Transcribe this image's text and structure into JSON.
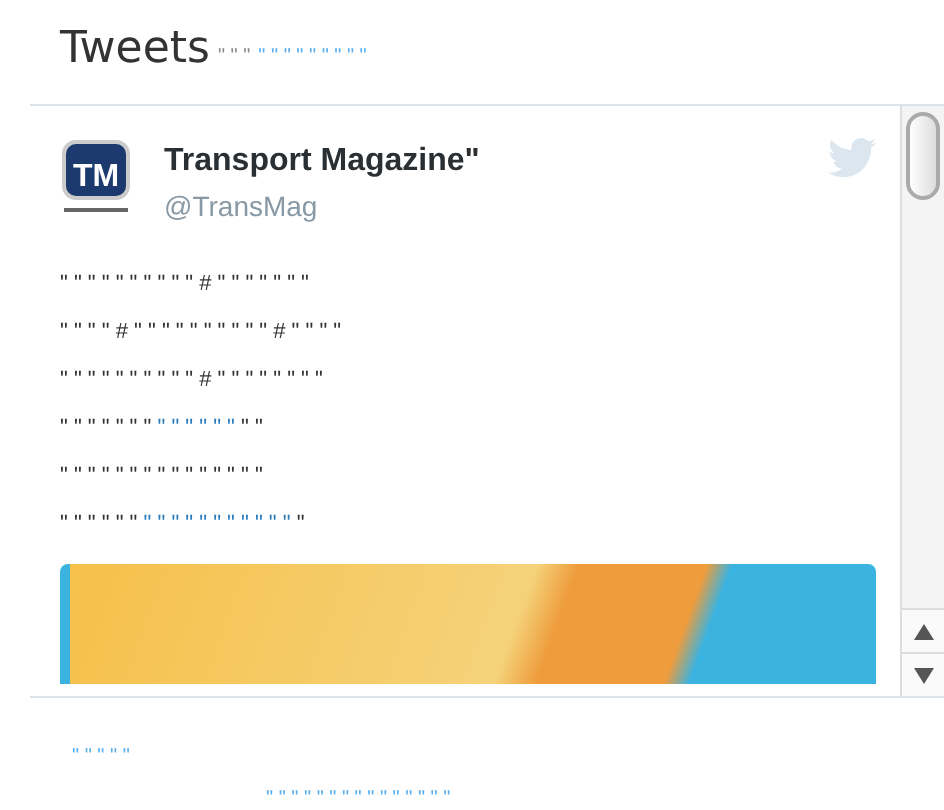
{
  "header": {
    "title": "Tweets",
    "segments": [
      {
        "kind": "text",
        "text": "\" \" \""
      },
      {
        "kind": "link",
        "text": "\" \" \" \" \" \" \" \" \""
      }
    ]
  },
  "tweet": {
    "logo": {
      "letters": "TM"
    },
    "name": "Transport Magazine\"",
    "handle": "@TransMag",
    "lines": [
      [
        {
          "kind": "text",
          "text": "\" \" \" \" \" \" \" \" \" \" # \" \" \" \" \" \" \""
        }
      ],
      [
        {
          "kind": "text",
          "text": "\" \" \" \" # \" \" \" \" \" \" \" \" \" \" # \" \" \" \""
        }
      ],
      [
        {
          "kind": "text",
          "text": "\" \" \" \" \" \" \" \" \" \" # \" \" \" \" \" \" \" \""
        }
      ],
      [
        {
          "kind": "text",
          "text": "\" \" \" \" \" \" \" "
        },
        {
          "kind": "link",
          "text": "\" \" \" \" \" \""
        },
        {
          "kind": "text",
          "text": " \" \""
        }
      ],
      [
        {
          "kind": "text",
          "text": "\" \" \" \" \" \" \" \" \" \" \" \" \" \" \""
        }
      ],
      [
        {
          "kind": "text",
          "text": "\" \" \" \" \" \" "
        },
        {
          "kind": "link",
          "text": "\" \" \" \" \" \" \" \" \" \" \""
        },
        {
          "kind": "text",
          "text": " \""
        }
      ]
    ]
  },
  "footer": {
    "links": [
      "\" \" \" \" \"",
      "\" \" \" \" \" \" \" \" \" \" \" \" \" \" \""
    ]
  }
}
